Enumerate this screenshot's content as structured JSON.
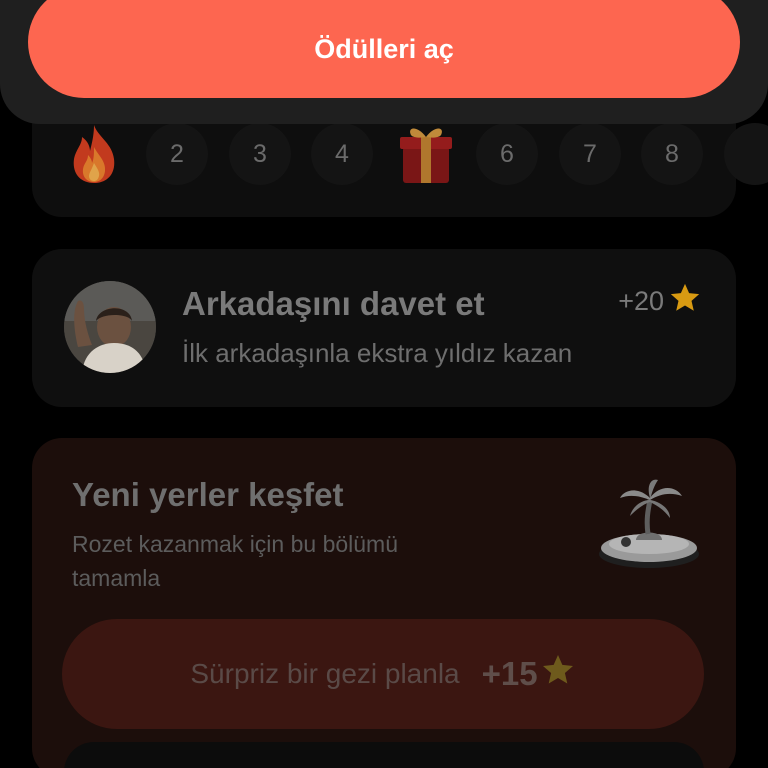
{
  "top": {
    "open_rewards_label": "Ödülleri aç"
  },
  "streak": {
    "days": [
      "2",
      "3",
      "4",
      "6",
      "7",
      "8"
    ],
    "icons": [
      "fire-icon",
      "gift-icon"
    ]
  },
  "invite": {
    "title": "Arkadaşını davet et",
    "subtitle": "İlk arkadaşınla ekstra yıldız kazan",
    "points": "+20"
  },
  "explore": {
    "title": "Yeni yerler keşfet",
    "subtitle": "Rozet kazanmak için bu bölümü tamamla",
    "action_label": "Sürpriz bir gezi planla",
    "action_points": "+15"
  },
  "colors": {
    "accent": "#fd6650",
    "star": "#f5b400",
    "background": "#000000"
  }
}
